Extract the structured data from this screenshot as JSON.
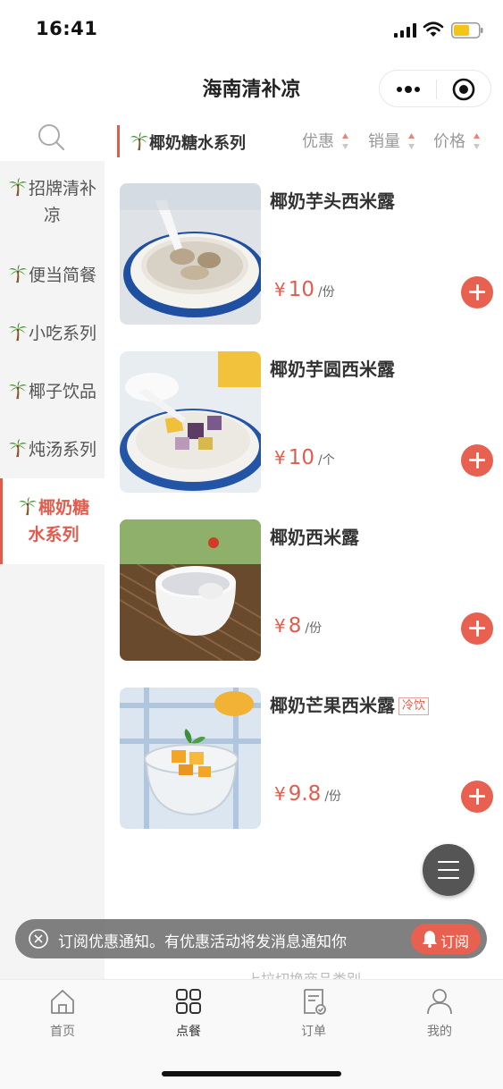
{
  "status_bar": {
    "time": "16:41"
  },
  "nav": {
    "title": "海南清补凉"
  },
  "sidebar": {
    "items": [
      {
        "line1": "招牌清补",
        "line2": "凉",
        "active": false
      },
      {
        "line1": "便当简餐",
        "line2": "",
        "active": false
      },
      {
        "line1": "小吃系列",
        "line2": "",
        "active": false
      },
      {
        "line1": "椰子饮品",
        "line2": "",
        "active": false
      },
      {
        "line1": "炖汤系列",
        "line2": "",
        "active": false
      },
      {
        "line1": "椰奶糖",
        "line2": "水系列",
        "active": true
      }
    ]
  },
  "sort_header": {
    "category": "椰奶糖水系列",
    "sorts": [
      {
        "label": "优惠"
      },
      {
        "label": "销量"
      },
      {
        "label": "价格"
      }
    ]
  },
  "products": [
    {
      "name": "椰奶芋头西米露",
      "tag": "",
      "currency": "¥",
      "price": "10",
      "unit": "/份"
    },
    {
      "name": "椰奶芋圆西米露",
      "tag": "",
      "currency": "¥",
      "price": "10",
      "unit": "/个"
    },
    {
      "name": "椰奶西米露",
      "tag": "",
      "currency": "¥",
      "price": "8",
      "unit": "/份"
    },
    {
      "name": "椰奶芒果西米露",
      "tag": "冷饮",
      "currency": "¥",
      "price": "9.8",
      "unit": "/份"
    }
  ],
  "hint": "— 上拉切换商品类别 —",
  "toast": {
    "text": "订阅优惠通知。有优惠活动将发消息通知你",
    "button": "订阅"
  },
  "tabbar": {
    "tabs": [
      {
        "label": "首页",
        "icon": "home-icon"
      },
      {
        "label": "点餐",
        "icon": "grid-icon"
      },
      {
        "label": "订单",
        "icon": "order-icon"
      },
      {
        "label": "我的",
        "icon": "user-icon"
      }
    ]
  },
  "colors": {
    "accent": "#e25c4d",
    "add_button": "#e8604f"
  }
}
